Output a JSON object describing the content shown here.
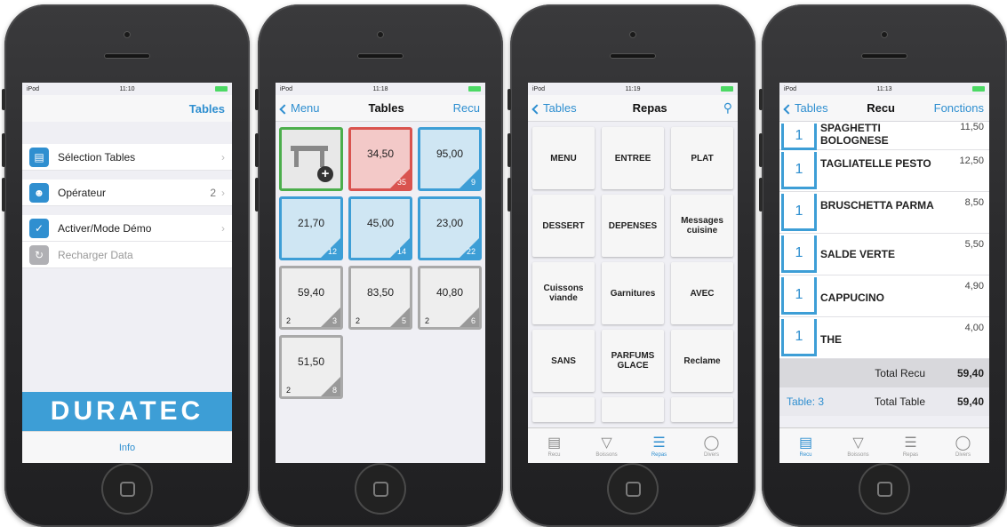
{
  "screen1": {
    "status": {
      "carrier": "iPod",
      "time": "11:10"
    },
    "nav_right": "Tables",
    "rows": [
      {
        "label": "Sélection Tables",
        "value": ""
      },
      {
        "label": "Opérateur",
        "value": "2"
      },
      {
        "label": "Activer/Mode Démo",
        "value": ""
      },
      {
        "label": "Recharger Data",
        "value": ""
      }
    ],
    "logo": "DURATEC",
    "info": "Info"
  },
  "screen2": {
    "status": {
      "carrier": "iPod",
      "time": "11:18"
    },
    "nav_left": "Menu",
    "title": "Tables",
    "nav_right": "Recu",
    "tables": [
      {
        "amount": "34,50",
        "number": "35",
        "guests": ""
      },
      {
        "amount": "95,00",
        "number": "9",
        "guests": ""
      },
      {
        "amount": "21,70",
        "number": "12",
        "guests": ""
      },
      {
        "amount": "45,00",
        "number": "14",
        "guests": ""
      },
      {
        "amount": "23,00",
        "number": "22",
        "guests": ""
      },
      {
        "amount": "59,40",
        "number": "3",
        "guests": "2"
      },
      {
        "amount": "83,50",
        "number": "5",
        "guests": "2"
      },
      {
        "amount": "40,80",
        "number": "6",
        "guests": "2"
      },
      {
        "amount": "51,50",
        "number": "8",
        "guests": "2"
      }
    ]
  },
  "screen3": {
    "status": {
      "carrier": "iPod",
      "time": "11:19"
    },
    "nav_left": "Tables",
    "title": "Repas",
    "categories": [
      "MENU",
      "ENTREE",
      "PLAT",
      "DESSERT",
      "DEPENSES",
      "Messages cuisine",
      "Cuissons viande",
      "Garnitures",
      "AVEC",
      "SANS",
      "PARFUMS GLACE",
      "Reclame"
    ],
    "tabs": [
      "Recu",
      "Boissons",
      "Repas",
      "Divers"
    ]
  },
  "screen4": {
    "status": {
      "carrier": "iPod",
      "time": "11:13"
    },
    "nav_left": "Tables",
    "title": "Recu",
    "nav_right": "Fonctions",
    "items": [
      {
        "qty": "1",
        "name": "SPAGHETTI BOLOGNESE",
        "price": "11,50"
      },
      {
        "qty": "1",
        "name": "TAGLIATELLE PESTO",
        "price": "12,50"
      },
      {
        "qty": "1",
        "name": "BRUSCHETTA PARMA",
        "price": "8,50"
      },
      {
        "qty": "1",
        "name": "SALDE VERTE",
        "price": "5,50"
      },
      {
        "qty": "1",
        "name": "CAPPUCINO",
        "price": "4,90"
      },
      {
        "qty": "1",
        "name": "THE",
        "price": "4,00"
      }
    ],
    "total_recu_label": "Total Recu",
    "total_recu": "59,40",
    "table_label": "Table: 3",
    "total_table_label": "Total Table",
    "total_table": "59,40",
    "tabs": [
      "Recu",
      "Boissons",
      "Repas",
      "Divers"
    ]
  }
}
